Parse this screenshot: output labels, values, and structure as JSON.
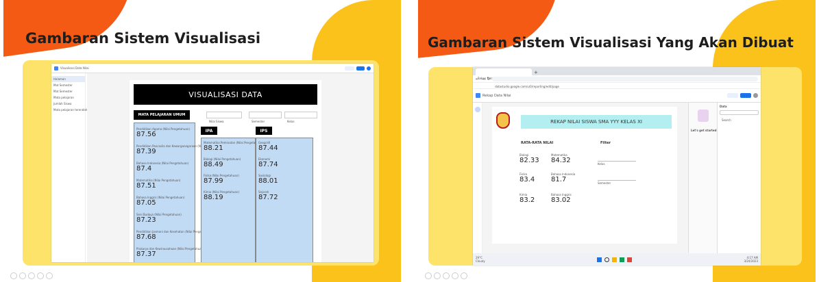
{
  "left_slide": {
    "title": "Gambaran Sistem Visualisasi",
    "app": {
      "name": "Visualisasi Data Nilai",
      "sidebar": [
        "Halaman",
        "Mat Semester",
        "Mat Semester",
        "Mata pelajaran",
        "Jumlah Siswa",
        "Mata pelajaran terendah"
      ],
      "header": "VISUALISASI DATA",
      "umum_label": "MATA PELAJARAN UMUM",
      "filters": [
        "Nilai Siswa",
        "Semester",
        "Kelas"
      ],
      "umum_values": [
        {
          "label": "Pendidikan Agama (Nilai Pengetahuan)",
          "value": "87.56"
        },
        {
          "label": "Pendidikan Pancasila dan Kewarganegaraan (Nilai Pengetahuan)",
          "value": "87.39"
        },
        {
          "label": "Bahasa Indonesia (Nilai Pengetahuan)",
          "value": "87.4"
        },
        {
          "label": "Matematika (Nilai Pengetahuan)",
          "value": "87.51"
        },
        {
          "label": "Bahasa Inggris (Nilai Pengetahuan)",
          "value": "87.05"
        },
        {
          "label": "Seni Budaya (Nilai Pengetahuan)",
          "value": "87.23"
        },
        {
          "label": "Pendidikan Jasmani dan Kesehatan (Nilai Pengetahuan)",
          "value": "87.68"
        },
        {
          "label": "Prakarya dan Kewirausahaan (Nilai Pengetahuan)",
          "value": "87.37"
        }
      ],
      "ipa_label": "IPA",
      "ipa_values": [
        {
          "label": "Matematika Peminatan (Nilai Pengetahuan)",
          "value": "88.21"
        },
        {
          "label": "Biologi (Nilai Pengetahuan)",
          "value": "88.49"
        },
        {
          "label": "Fisika (Nilai Pengetahuan)",
          "value": "87.99"
        },
        {
          "label": "Kimia (Nilai Pengetahuan)",
          "value": "88.19"
        }
      ],
      "ips_label": "IPS",
      "ips_values": [
        {
          "label": "Geografi",
          "value": "87.44"
        },
        {
          "label": "Ekonomi",
          "value": "87.74"
        },
        {
          "label": "Sosiologi",
          "value": "88.01"
        },
        {
          "label": "Sejarah",
          "value": "87.72"
        }
      ]
    }
  },
  "right_slide": {
    "title": "Gambaran Sistem Visualisasi Yang Akan Dibuat",
    "browser": {
      "tab": "Rekap Data Nilai - Rekap Nilai",
      "url": "datastudio.google.com/u/0/reporting/edit/page"
    },
    "app": {
      "name": "Rekap Data Nilai",
      "report_title": "REKAP NILAI SISWA SMA YYY KELAS XI",
      "section_label": "RATA-RATA NILAI",
      "filter_label": "Filter",
      "filters": [
        "Kelas",
        "Semester"
      ],
      "values": [
        {
          "label": "Biologi",
          "value": "82.33"
        },
        {
          "label": "Matematika",
          "value": "84.32"
        },
        {
          "label": "Fisika",
          "value": "83.4"
        },
        {
          "label": "Bahasa Indonesia",
          "value": "81.7"
        },
        {
          "label": "Kimia",
          "value": "83.2"
        },
        {
          "label": "Bahasa Inggris",
          "value": "83.02"
        }
      ],
      "side_panel": {
        "heading": "Let's get started",
        "data_label": "Data",
        "search": "Search"
      }
    },
    "taskbar": {
      "weather_temp": "29°C",
      "weather_desc": "Cloudy",
      "time": "4:17 AM",
      "date": "3/24/2023"
    }
  },
  "colors": {
    "orange": "#f45a14",
    "yellow": "#fcc21c",
    "pale_yellow": "#fde36a",
    "panel_blue": "#c2dbf5",
    "report_teal": "#b3eef0"
  }
}
